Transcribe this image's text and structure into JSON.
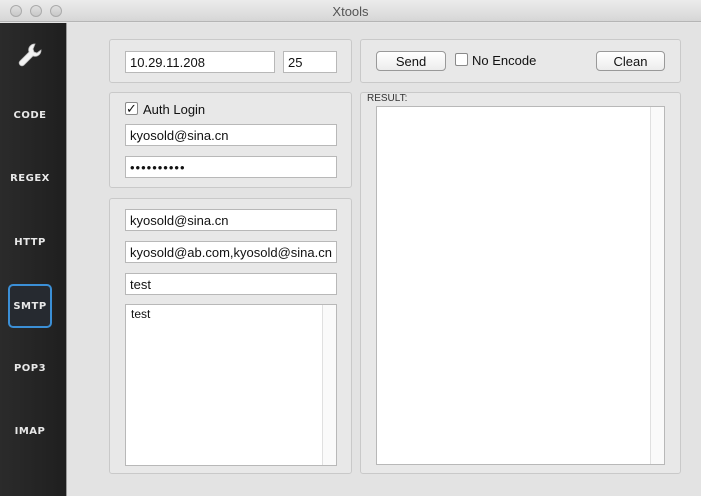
{
  "window": {
    "title": "Xtools"
  },
  "sidebar": {
    "items": [
      {
        "label": "CODE"
      },
      {
        "label": "REGEX"
      },
      {
        "label": "HTTP"
      },
      {
        "label": "SMTP"
      },
      {
        "label": "POP3"
      },
      {
        "label": "IMAP"
      }
    ],
    "active": "SMTP"
  },
  "server": {
    "host": "10.29.11.208",
    "port": "25"
  },
  "auth": {
    "checkbox_label": "Auth Login",
    "checked": true,
    "username": "kyosold@sina.cn",
    "password": "••••••••••"
  },
  "mail": {
    "from": "kyosold@sina.cn",
    "to": "kyosold@ab.com,kyosold@sina.cn",
    "subject": "test",
    "body": "test"
  },
  "toolbar": {
    "send_label": "Send",
    "no_encode_label": "No Encode",
    "clean_label": "Clean"
  },
  "result": {
    "label": "RESULT:",
    "text": ""
  },
  "colors": {
    "sidebar_bg": "#222222",
    "active_border": "#3b8fd6"
  }
}
